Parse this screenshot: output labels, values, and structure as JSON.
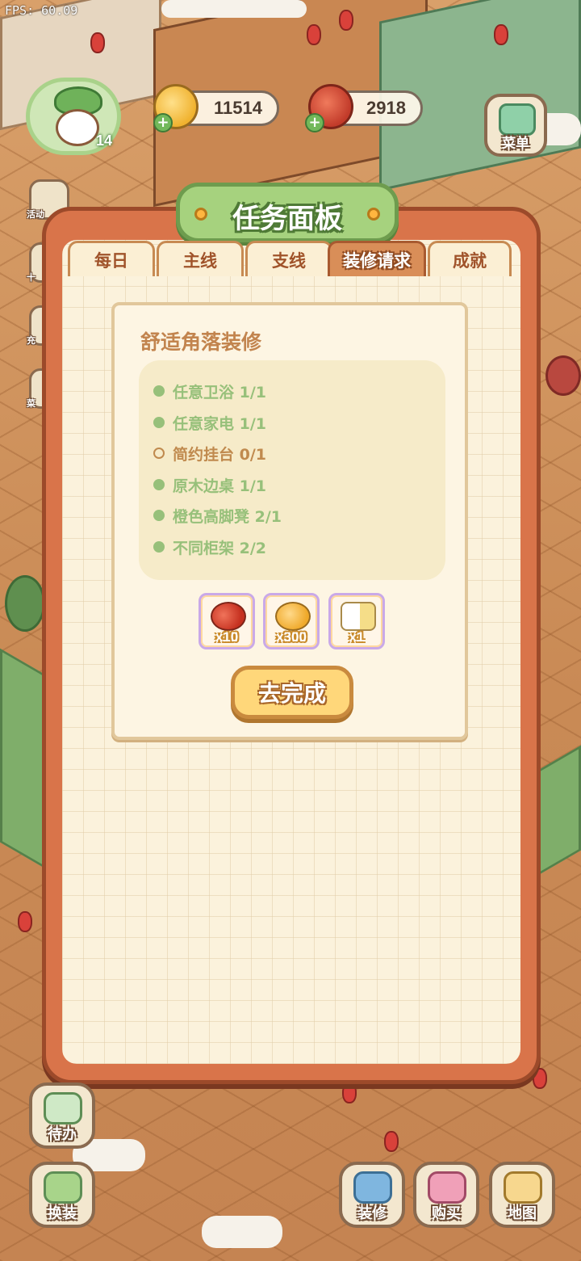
{
  "hud": {
    "fps": "FPS: 60.09",
    "level": "14",
    "coins": "11514",
    "cherries": "2918",
    "menu_label": "菜单",
    "left_labels": [
      "活动",
      "十",
      "充",
      "菜"
    ]
  },
  "panel": {
    "title": "任务面板",
    "tabs": [
      {
        "label": "每日"
      },
      {
        "label": "主线"
      },
      {
        "label": "支线"
      },
      {
        "label": "装修请求"
      },
      {
        "label": "成就"
      }
    ],
    "active_tab": "装修请求"
  },
  "task": {
    "title": "舒适角落装修",
    "requirements": [
      {
        "text": "任意卫浴 1/1",
        "status": "done"
      },
      {
        "text": "任意家电 1/1",
        "status": "done"
      },
      {
        "text": "简约挂台 0/1",
        "status": "pending"
      },
      {
        "text": "原木边桌 1/1",
        "status": "done"
      },
      {
        "text": "橙色高脚凳 2/1",
        "status": "done"
      },
      {
        "text": "不同柜架 2/2",
        "status": "done"
      }
    ],
    "rewards": [
      {
        "icon": "cherry-icon",
        "qty": "x10"
      },
      {
        "icon": "coin-pile-icon",
        "qty": "x300"
      },
      {
        "icon": "avatar-token-icon",
        "qty": "x1"
      }
    ],
    "complete_label": "去完成"
  },
  "bottom_bar": {
    "todo": "待办",
    "dress": "换装",
    "decorate": "装修",
    "buy": "购买",
    "map": "地图"
  },
  "colors": {
    "done": "#97c07a",
    "pending": "#c08a4e",
    "panel_border": "#d9744a",
    "title_plate": "#a6d27e"
  }
}
